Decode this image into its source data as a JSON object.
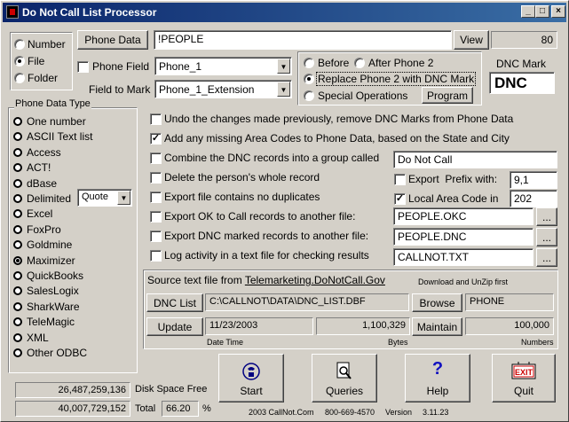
{
  "window": {
    "title": "Do Not Call List Processor",
    "min": "_",
    "max": "□",
    "close": "×"
  },
  "source_radio": [
    {
      "label": "Number",
      "selected": false
    },
    {
      "label": "File",
      "selected": true
    },
    {
      "label": "Folder",
      "selected": false
    }
  ],
  "phone_data": {
    "button": "Phone Data",
    "value": "!PEOPLE",
    "view_button": "View",
    "count": "80"
  },
  "phone_field": {
    "label": "Phone Field",
    "value": "Phone_1",
    "checked": false
  },
  "field_to_mark": {
    "label": "Field to Mark",
    "value": "Phone_1_Extension"
  },
  "placement": {
    "before": "Before",
    "after": "After Phone 2",
    "replace": "Replace Phone 2 with DNC Mark",
    "special": "Special Operations",
    "program_button": "Program",
    "selected": "replace"
  },
  "dnc_mark": {
    "label": "DNC Mark",
    "value": "DNC"
  },
  "phone_data_type": {
    "title": "Phone Data Type",
    "options": [
      "One number",
      "ASCII Text list",
      "Access",
      "ACT!",
      "dBase",
      "Delimited",
      "Excel",
      "FoxPro",
      "Goldmine",
      "Maximizer",
      "QuickBooks",
      "SalesLogix",
      "SharkWare",
      "TeleMagic",
      "XML",
      "Other ODBC"
    ],
    "selected": "Maximizer",
    "delimiter": "Quote"
  },
  "options": {
    "undo": "Undo the changes made previously, remove DNC Marks from Phone Data",
    "area_codes": "Add any missing Area Codes to Phone Data, based on the State and City",
    "combine": "Combine the DNC records into a group called",
    "combine_value": "Do Not Call",
    "delete": "Delete the person's whole record",
    "export_prefix": "Export  Prefix with:",
    "prefix_value": "9,1",
    "no_dupes": "Export file contains no duplicates",
    "local_area": "Local Area Code in",
    "local_value": "202",
    "export_ok": "Export OK to Call records to another file:",
    "export_ok_value": "PEOPLE.OKC",
    "export_dnc": "Export DNC marked records to another file:",
    "export_dnc_value": "PEOPLE.DNC",
    "log": "Log activity in a text file for checking results",
    "log_value": "CALLNOT.TXT",
    "browse_small": "..."
  },
  "source": {
    "label": "Source text file from",
    "link": "Telemarketing.DoNotCall.Gov",
    "note": "Download and UnZip first",
    "dnc_list_button": "DNC List",
    "path": "C:\\CALLNOT\\DATA\\DNC_LIST.DBF",
    "browse_button": "Browse",
    "field": "PHONE",
    "update_button": "Update",
    "date": "11/23/2003",
    "bytes": "1,100,329",
    "maintain_button": "Maintain",
    "numbers": "100,000",
    "date_label": "Date Time",
    "bytes_label": "Bytes",
    "numbers_label": "Numbers"
  },
  "disk": {
    "free_value": "26,487,259,136",
    "free_label": "Disk Space Free",
    "total_value": "40,007,729,152",
    "total_label": "Total",
    "percent_value": "66.20",
    "percent_sign": "%"
  },
  "actions": {
    "start": "Start",
    "queries": "Queries",
    "help": "Help",
    "quit": "Quit",
    "exit_sign": "EXIT"
  },
  "footer": {
    "copyright": "2003 CallNot.Com",
    "phone": "800-669-4570",
    "version_label": "Version",
    "version": "3.11.23"
  }
}
